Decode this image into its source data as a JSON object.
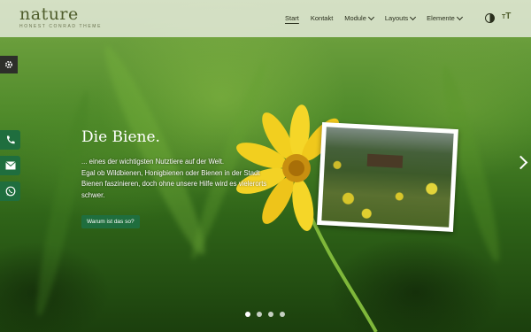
{
  "brand": {
    "logo": "nature",
    "tagline": "HONEST CONRAD THEME"
  },
  "nav": {
    "items": [
      {
        "label": "Start",
        "active": true,
        "dropdown": false
      },
      {
        "label": "Kontakt",
        "active": false,
        "dropdown": false
      },
      {
        "label": "Module",
        "active": false,
        "dropdown": true
      },
      {
        "label": "Layouts",
        "active": false,
        "dropdown": true
      },
      {
        "label": "Elemente",
        "active": false,
        "dropdown": true
      }
    ],
    "contrast_icon": "contrast-icon",
    "text_size_icon": "text-size-icon",
    "text_size_glyph": {
      "big": "T",
      "small": "T"
    }
  },
  "side_buttons": [
    {
      "icon": "phone-icon"
    },
    {
      "icon": "mail-icon"
    },
    {
      "icon": "whatsapp-icon"
    }
  ],
  "settings_icon": "gear-icon",
  "slide": {
    "title": "Die Biene.",
    "lines": [
      "... eines der wichtigsten Nutztiere auf der Welt.",
      "Egal ob Wildbienen, Honigbienen oder Bienen in der Stadt",
      "Bienen faszinieren, doch ohne unsere Hilfe wird es vielerorts",
      "schwer."
    ],
    "button": "Warum ist das so?"
  },
  "slider": {
    "next_icon": "chevron-right-icon",
    "dot_count": 4,
    "active_dot": 0
  },
  "colors": {
    "accent_green": "#1f6e3e",
    "header_bg": "#ebeee4",
    "logo_olive": "#4f5d2c"
  }
}
